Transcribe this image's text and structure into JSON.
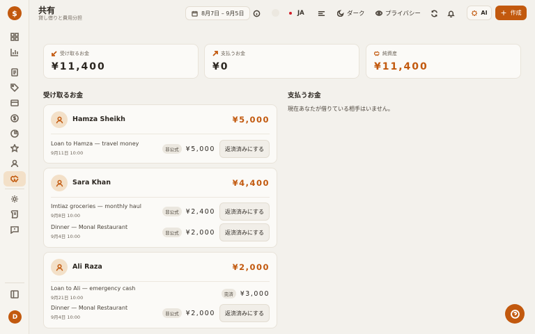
{
  "app": {
    "logo_symbol": "$",
    "user_initial": "D",
    "accent": "#c2590e"
  },
  "header": {
    "title": "共有",
    "subtitle": "貸し借りと費用分担",
    "date_range": "8月7日 – 9月5日",
    "language": "JA",
    "theme_label": "ダーク",
    "privacy_label": "プライバシー",
    "ai_label": "AI",
    "create_label": "作成"
  },
  "summary": {
    "receivable": {
      "label": "受け取るお金",
      "value": "¥11,400"
    },
    "payable": {
      "label": "支払うお金",
      "value": "¥0"
    },
    "net": {
      "label": "純資産",
      "value": "¥11,400"
    }
  },
  "sections": {
    "receivable_title": "受け取るお金",
    "payable_title": "支払うお金",
    "payable_empty": "現在あなたが借りている相手はいません。"
  },
  "people": [
    {
      "name": "Hamza Sheikh",
      "total": "¥5,000",
      "rows": [
        {
          "desc": "Loan to Hamza — travel money",
          "date": "9月11日 10:00",
          "tag": "非公式",
          "amount": "¥5,000",
          "action": "返済済みにする"
        }
      ]
    },
    {
      "name": "Sara Khan",
      "total": "¥4,400",
      "rows": [
        {
          "desc": "Imtiaz groceries — monthly haul",
          "date": "9月8日 10:00",
          "tag": "非公式",
          "amount": "¥2,400",
          "action": "返済済みにする"
        },
        {
          "desc": "Dinner — Monal Restaurant",
          "date": "9月4日 10:00",
          "tag": "非公式",
          "amount": "¥2,000",
          "action": "返済済みにする"
        }
      ]
    },
    {
      "name": "Ali Raza",
      "total": "¥2,000",
      "rows": [
        {
          "desc": "Loan to Ali — emergency cash",
          "date": "9月21日 10:00",
          "tag": "完済",
          "amount": "¥3,000"
        },
        {
          "desc": "Dinner — Monal Restaurant",
          "date": "9月4日 10:00",
          "tag": "非公式",
          "amount": "¥2,000",
          "action": "返済済みにする"
        }
      ]
    }
  ]
}
